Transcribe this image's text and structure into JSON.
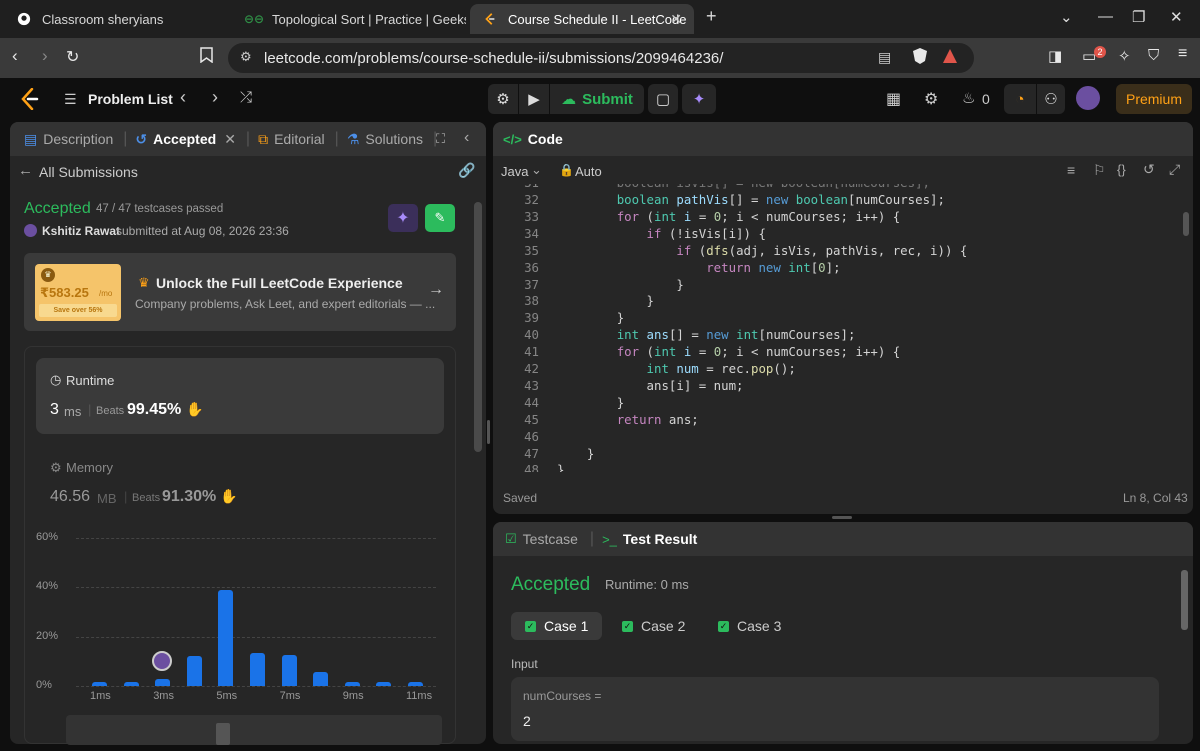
{
  "browser": {
    "tabs": [
      {
        "title": "Classroom sheryians",
        "icon": "github-icon"
      },
      {
        "title": "Topological Sort | Practice | GeeksforG",
        "icon": "gfg-icon"
      },
      {
        "title": "Course Schedule II - LeetCode",
        "icon": "leetcode-icon",
        "active": true
      }
    ],
    "url": "leetcode.com/problems/course-schedule-ii/submissions/2099464236/",
    "notif_count": "2"
  },
  "header": {
    "problem_list": "Problem List",
    "submit": "Submit",
    "streak": "0",
    "premium": "Premium"
  },
  "left": {
    "tabs": [
      "Description",
      "Accepted",
      "Editorial",
      "Solutions"
    ],
    "all_submissions": "All Submissions",
    "status": "Accepted",
    "testcases": "47 / 47 testcases passed",
    "user": "Kshitiz Rawat",
    "submitted": "submitted at Aug 08, 2026 23:36",
    "promo": {
      "price": "₹583.25",
      "per": "/mo",
      "save": "Save over 56%",
      "title": "Unlock the Full LeetCode Experience",
      "subtitle": "Company problems, Ask Leet, and expert editorials — ..."
    },
    "runtime": {
      "label": "Runtime",
      "value": "3",
      "unit": "ms",
      "beats_label": "Beats",
      "beats": "99.45%"
    },
    "memory": {
      "label": "Memory",
      "value": "46.56",
      "unit": "MB",
      "beats_label": "Beats",
      "beats": "91.30%"
    }
  },
  "chart_data": {
    "type": "bar",
    "categories": [
      "1ms",
      "2ms",
      "3ms",
      "4ms",
      "5ms",
      "6ms",
      "7ms",
      "8ms",
      "9ms",
      "10ms",
      "11ms"
    ],
    "values": [
      1.5,
      1.5,
      3,
      12,
      39,
      13.5,
      12.5,
      5.5,
      1.5,
      1.5,
      1.5
    ],
    "x_tick_labels": [
      "1ms",
      "3ms",
      "5ms",
      "7ms",
      "9ms",
      "11ms"
    ],
    "y_tick_labels": [
      "60%",
      "40%",
      "20%",
      "0%"
    ],
    "ylim": [
      0,
      60
    ],
    "grid": true,
    "highlight_category": "3ms"
  },
  "code": {
    "title": "Code",
    "language": "Java",
    "mode": "Auto",
    "saved": "Saved",
    "cursor": "Ln 8, Col 43",
    "lines": [
      {
        "n": "32",
        "html": "        <span class='ty'>boolean</span> <span class='vr'>pathVis</span><span class='tx'>[] = </span><span class='kw'>new</span> <span class='ty'>boolean</span><span class='tx'>[numCourses];</span>"
      },
      {
        "n": "33",
        "html": "        <span class='pk'>for</span> <span class='tx'>(</span><span class='ty'>int</span> <span class='vr'>i</span> <span class='tx'>= </span><span class='nm'>0</span><span class='tx'>; i &lt; numCourses; i++) {</span>"
      },
      {
        "n": "34",
        "html": "            <span class='pk'>if</span> <span class='tx'>(!isVis[i]) {</span>"
      },
      {
        "n": "35",
        "html": "                <span class='pk'>if</span> <span class='tx'>(</span><span class='fn'>dfs</span><span class='tx'>(adj, isVis, pathVis, rec, i)) {</span>"
      },
      {
        "n": "36",
        "html": "                    <span class='pk'>return</span> <span class='kw'>new</span> <span class='ty'>int</span><span class='tx'>[</span><span class='nm'>0</span><span class='tx'>];</span>"
      },
      {
        "n": "37",
        "html": "                <span class='tx'>}</span>"
      },
      {
        "n": "38",
        "html": "            <span class='tx'>}</span>"
      },
      {
        "n": "39",
        "html": "        <span class='tx'>}</span>"
      },
      {
        "n": "40",
        "html": "        <span class='ty'>int</span> <span class='vr'>ans</span><span class='tx'>[] = </span><span class='kw'>new</span> <span class='ty'>int</span><span class='tx'>[numCourses];</span>"
      },
      {
        "n": "41",
        "html": "        <span class='pk'>for</span> <span class='tx'>(</span><span class='ty'>int</span> <span class='vr'>i</span> <span class='tx'>= </span><span class='nm'>0</span><span class='tx'>; i &lt; numCourses; i++) {</span>"
      },
      {
        "n": "42",
        "html": "            <span class='ty'>int</span> <span class='vr'>num</span> <span class='tx'>= rec.</span><span class='fn'>pop</span><span class='tx'>();</span>"
      },
      {
        "n": "43",
        "html": "            <span class='tx'>ans[i] = num;</span>"
      },
      {
        "n": "44",
        "html": "        <span class='tx'>}</span>"
      },
      {
        "n": "45",
        "html": "        <span class='pk'>return</span> <span class='tx'>ans;</span>"
      },
      {
        "n": "46",
        "html": ""
      },
      {
        "n": "47",
        "html": "    <span class='tx'>}</span>"
      },
      {
        "n": "48",
        "html": "<span class='tx'>}</span>"
      }
    ]
  },
  "result": {
    "tab_testcase": "Testcase",
    "tab_result": "Test Result",
    "status": "Accepted",
    "runtime": "Runtime: 0 ms",
    "cases": [
      "Case 1",
      "Case 2",
      "Case 3"
    ],
    "input_label": "Input",
    "param_name": "numCourses =",
    "param_value": "2"
  }
}
